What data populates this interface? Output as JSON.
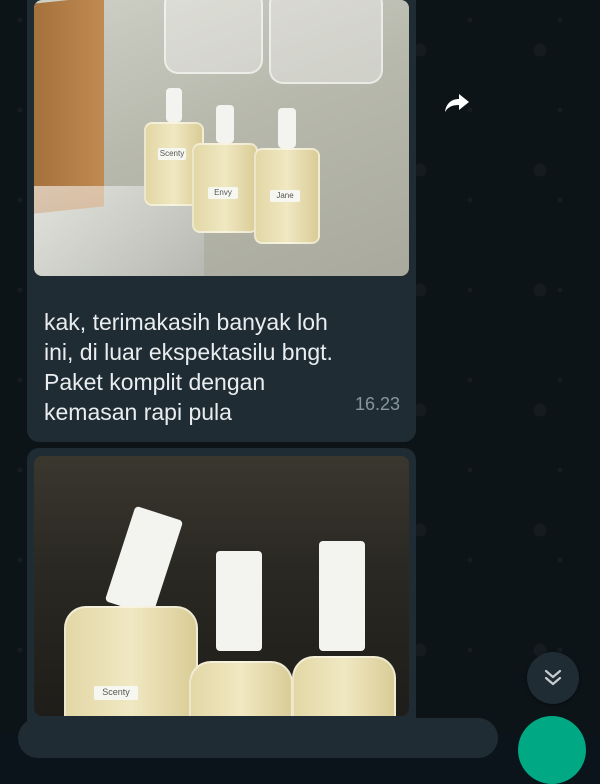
{
  "messages": [
    {
      "type": "image_with_caption",
      "caption_lines": [
        "kak, terimakasih banyak loh",
        "ini, di luar ekspektasilu bngt.",
        "Paket komplit dengan",
        "kemasan rapi pula"
      ],
      "time": "16.23",
      "bottle_labels": [
        "Scenty",
        "Envy",
        "Jane"
      ]
    },
    {
      "type": "image",
      "bottle_labels": [
        "Scenty"
      ]
    }
  ],
  "icons": {
    "forward": "forward-arrow-icon",
    "scroll_down": "double-chevron-down-icon"
  },
  "colors": {
    "background": "#0b141a",
    "bubble": "#1f2c34",
    "text": "#e9edef",
    "timestamp": "#8696a0",
    "accent": "#00a884"
  }
}
